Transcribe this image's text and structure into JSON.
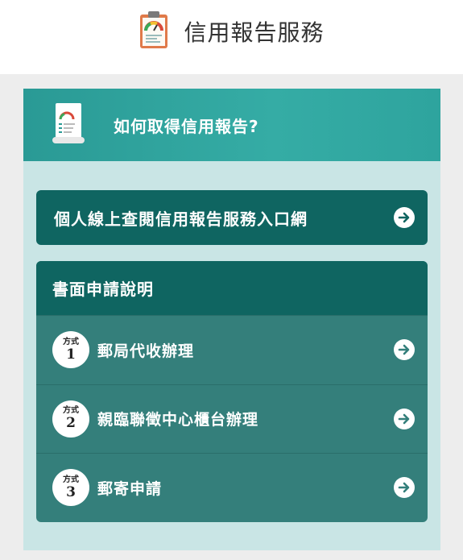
{
  "header": {
    "title": "信用報告服務",
    "icon": "clipboard-gauge-icon"
  },
  "panel": {
    "title": "如何取得信用報告?",
    "icon": "report-document-icon",
    "portal": {
      "label": "個人線上查閱信用報告服務入口網",
      "icon": "arrow-right-circle-icon"
    },
    "paper": {
      "title": "書面申請說明",
      "methods": [
        {
          "badge_top": "方式",
          "badge_num": "1",
          "label": "郵局代收辦理"
        },
        {
          "badge_top": "方式",
          "badge_num": "2",
          "label": "親臨聯徵中心櫃台辦理"
        },
        {
          "badge_top": "方式",
          "badge_num": "3",
          "label": "郵寄申請"
        }
      ]
    }
  },
  "colors": {
    "accent_dark": "#0f6561",
    "accent_mid": "#347f7b",
    "accent_light": "#2ea49e",
    "panel_bg": "#c9e5e5"
  }
}
